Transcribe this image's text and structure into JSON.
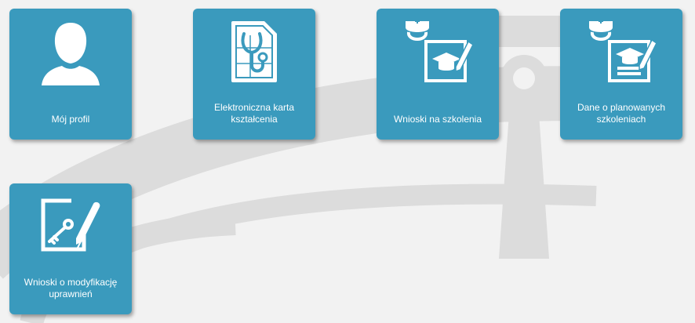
{
  "colors": {
    "tile": "#3a9abd",
    "background": "#f2f2f2",
    "watermark": "#dcdcdc"
  },
  "tiles": [
    {
      "label": "Mój profil",
      "icon": "user-silhouette-icon"
    },
    {
      "label": "Elektroniczna karta kształcenia",
      "icon": "sim-card-stethoscope-icon"
    },
    {
      "label": "Wnioski na szkolenia",
      "icon": "nurse-cap-certificate-icon"
    },
    {
      "label": "Dane o planowanych szkoleniach",
      "icon": "nurse-cap-plan-icon"
    },
    {
      "label": "Wnioski o modyfikację uprawnień",
      "icon": "key-document-pen-icon"
    }
  ]
}
